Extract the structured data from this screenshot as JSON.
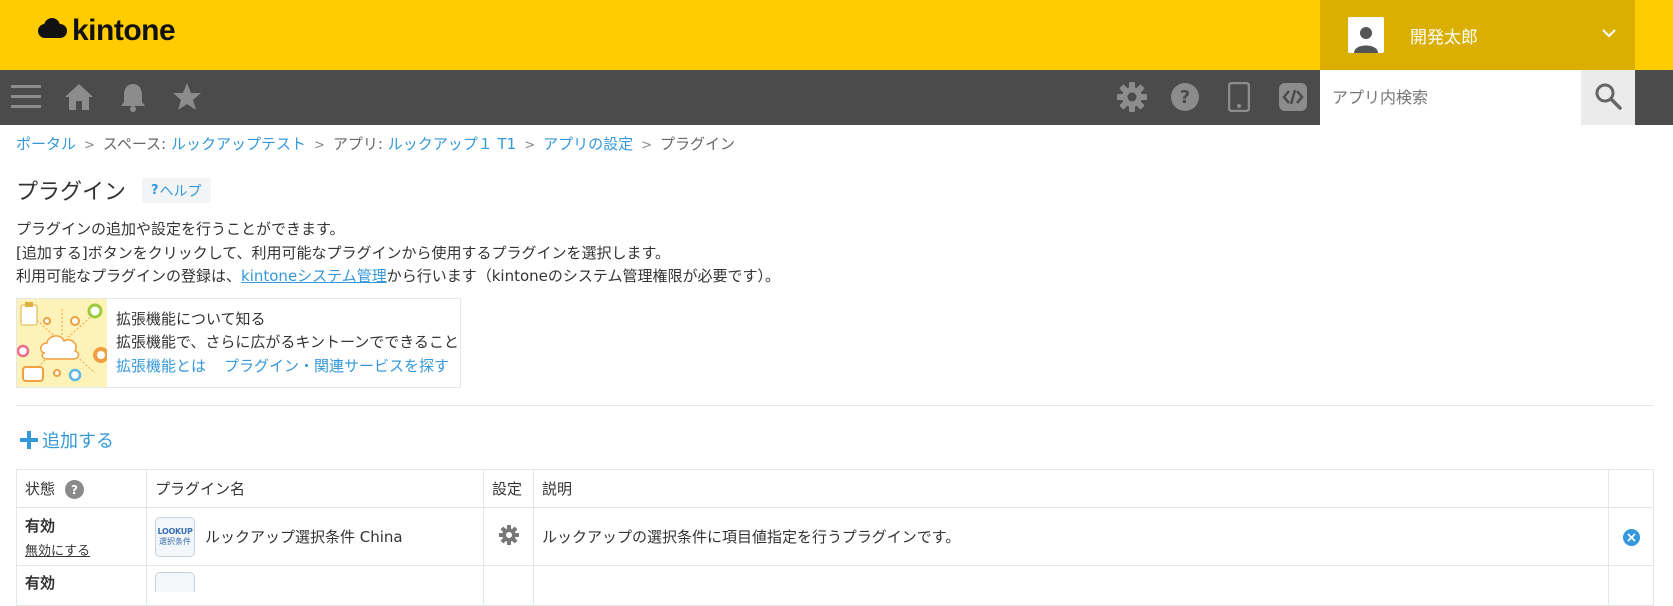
{
  "header": {
    "logo_text": "kintone",
    "user_name": "開発太郎"
  },
  "toolbar": {
    "icons": [
      "menu-icon",
      "home-icon",
      "bell-icon",
      "star-icon",
      "gear-icon",
      "help-icon",
      "mobile-icon",
      "code-icon"
    ],
    "search_placeholder": "アプリ内検索"
  },
  "breadcrumb": {
    "portal": "ポータル",
    "space_prefix": "スペース: ",
    "space_name": "ルックアップテスト",
    "app_prefix": "アプリ: ",
    "app_name": "ルックアップ１ T1",
    "app_settings": "アプリの設定",
    "current": "プラグイン",
    "separator": ">"
  },
  "page": {
    "title": "プラグイン",
    "help_mark": "?",
    "help_label": "ヘルプ",
    "desc_line1": "プラグインの追加や設定を行うことができます。",
    "desc_line2": "[追加する]ボタンをクリックして、利用可能なプラグインから使用するプラグインを選択します。",
    "desc_line3_before": "利用可能なプラグインの登録は、",
    "desc_line3_link": "kintoneシステム管理",
    "desc_line3_after": "から行います（kintoneのシステム管理権限が必要です）。"
  },
  "extension": {
    "title": "拡張機能について知る",
    "subtitle": "拡張機能で、さらに広がるキントーンでできること",
    "link1": "拡張機能とは",
    "link2": "プラグイン・関連サービスを探す"
  },
  "add_label": "追加する",
  "table": {
    "headers": {
      "status": "状態",
      "status_help": "?",
      "name": "プラグイン名",
      "settings": "設定",
      "description": "説明"
    },
    "rows": [
      {
        "status": "有効",
        "action": "無効にする",
        "icon_line1": "LOOKUP",
        "icon_line2": "選択条件",
        "name": "ルックアップ選択条件 China",
        "description": "ルックアップの選択条件に項目値指定を行うプラグインです。"
      },
      {
        "status": "有効"
      }
    ]
  },
  "colors": {
    "header_bg": "#fecc00",
    "user_bg": "#dbaf00",
    "toolbar_bg": "#4b4b4b",
    "link": "#3498db"
  }
}
